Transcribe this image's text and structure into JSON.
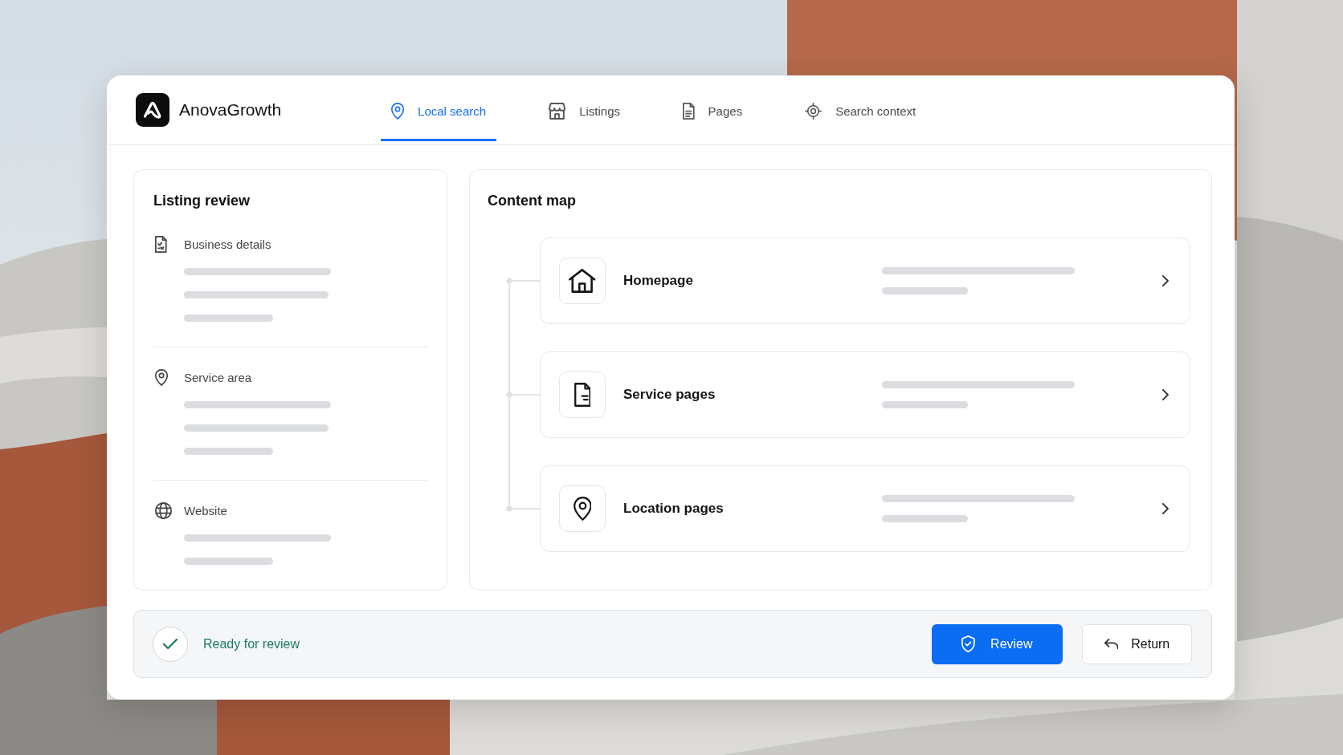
{
  "brand": {
    "name": "AnovaGrowth"
  },
  "tabs": [
    {
      "label": "Local search",
      "selected": true
    },
    {
      "label": "Listings",
      "selected": false
    },
    {
      "label": "Pages",
      "selected": false
    },
    {
      "label": "Search context",
      "selected": false
    }
  ],
  "listing_review": {
    "title": "Listing review",
    "sections": [
      {
        "label": "Business details"
      },
      {
        "label": "Service area"
      },
      {
        "label": "Website"
      }
    ]
  },
  "content_map": {
    "title": "Content map",
    "pages": [
      {
        "title": "Homepage"
      },
      {
        "title": "Service pages"
      },
      {
        "title": "Location pages"
      }
    ]
  },
  "status_bar": {
    "status": "Ready for review",
    "buttons": [
      {
        "label": "Review",
        "kind": "primary"
      },
      {
        "label": "Return",
        "kind": "secondary"
      }
    ]
  }
}
